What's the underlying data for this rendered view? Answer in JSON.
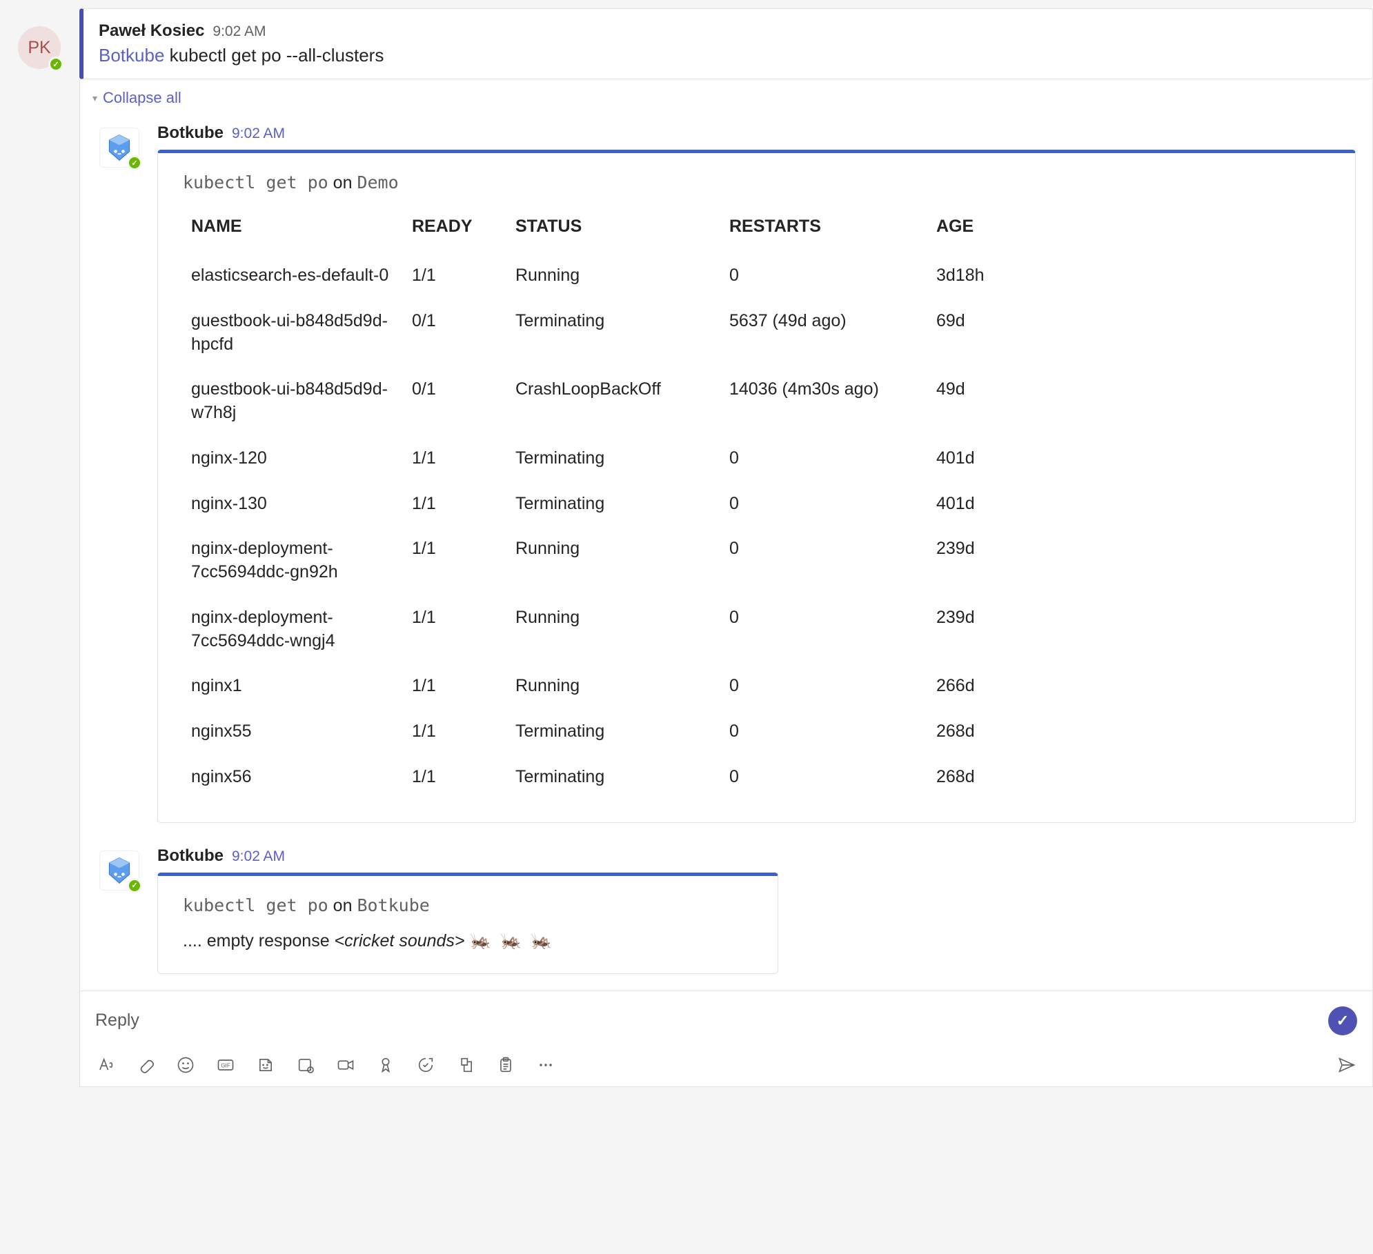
{
  "user_message": {
    "avatar_initials": "PK",
    "author": "Paweł Kosiec",
    "timestamp": "9:02 AM",
    "link_text": "Botkube",
    "command_text": "kubectl get po --all-clusters"
  },
  "collapse_label": "Collapse all",
  "reply1": {
    "author": "Botkube",
    "timestamp": "9:02 AM",
    "command": "kubectl get po",
    "on_word": "on",
    "cluster": "Demo",
    "headers": {
      "name": "NAME",
      "ready": "READY",
      "status": "STATUS",
      "restarts": "RESTARTS",
      "age": "AGE"
    },
    "rows": [
      {
        "name": "elasticsearch-es-default-0",
        "ready": "1/1",
        "status": "Running",
        "restarts": "0",
        "age": "3d18h"
      },
      {
        "name": "guestbook-ui-b848d5d9d-hpcfd",
        "ready": "0/1",
        "status": "Terminating",
        "restarts": "5637 (49d ago)",
        "age": "69d"
      },
      {
        "name": "guestbook-ui-b848d5d9d-w7h8j",
        "ready": "0/1",
        "status": "CrashLoopBackOff",
        "restarts": "14036 (4m30s ago)",
        "age": "49d"
      },
      {
        "name": "nginx-120",
        "ready": "1/1",
        "status": "Terminating",
        "restarts": "0",
        "age": "401d"
      },
      {
        "name": "nginx-130",
        "ready": "1/1",
        "status": "Terminating",
        "restarts": "0",
        "age": "401d"
      },
      {
        "name": "nginx-deployment-7cc5694ddc-gn92h",
        "ready": "1/1",
        "status": "Running",
        "restarts": "0",
        "age": "239d"
      },
      {
        "name": "nginx-deployment-7cc5694ddc-wngj4",
        "ready": "1/1",
        "status": "Running",
        "restarts": "0",
        "age": "239d"
      },
      {
        "name": "nginx1",
        "ready": "1/1",
        "status": "Running",
        "restarts": "0",
        "age": "266d"
      },
      {
        "name": "nginx55",
        "ready": "1/1",
        "status": "Terminating",
        "restarts": "0",
        "age": "268d"
      },
      {
        "name": "nginx56",
        "ready": "1/1",
        "status": "Terminating",
        "restarts": "0",
        "age": "268d"
      }
    ]
  },
  "reply2": {
    "author": "Botkube",
    "timestamp": "9:02 AM",
    "command": "kubectl get po",
    "on_word": "on",
    "cluster": "Botkube",
    "empty_prefix": ".... empty response ",
    "empty_italic": "<cricket sounds>",
    "crickets": "🦗 🦗 🦗"
  },
  "reply_input": {
    "placeholder": "Reply"
  }
}
